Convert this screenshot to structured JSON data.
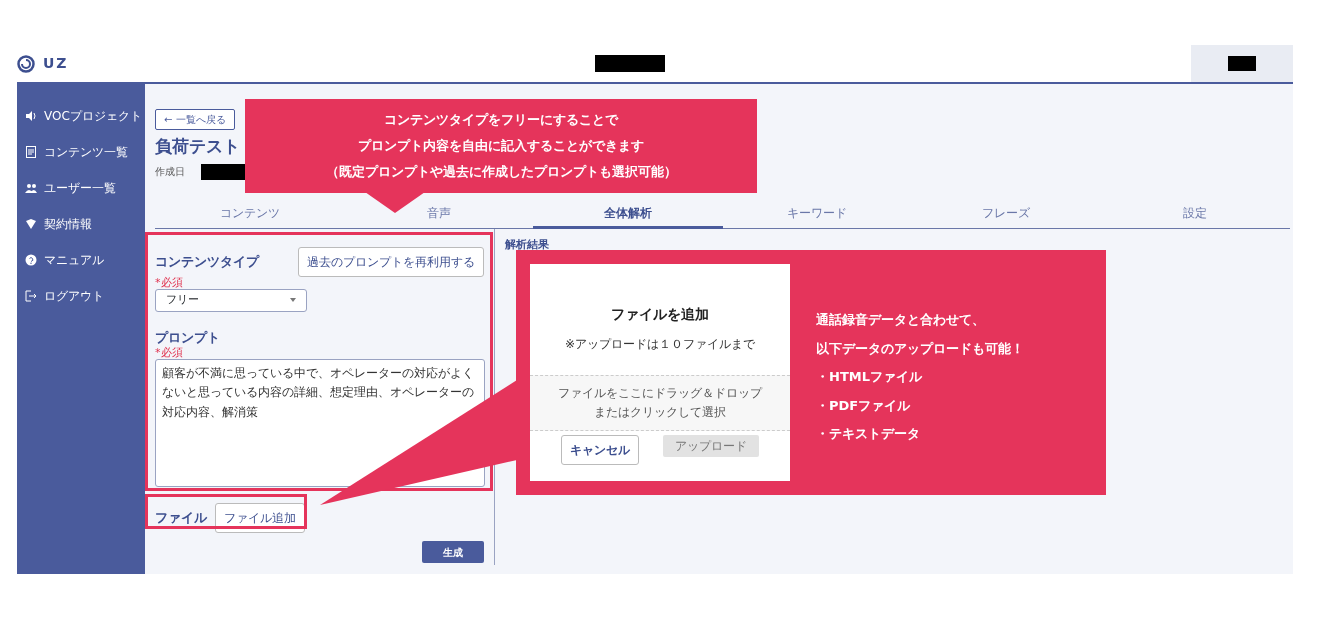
{
  "header": {
    "logo": "UZ"
  },
  "sidebar": {
    "items": [
      {
        "label": "VOCプロジェクト"
      },
      {
        "label": "コンテンツ一覧"
      },
      {
        "label": "ユーザー一覧"
      },
      {
        "label": "契約情報"
      },
      {
        "label": "マニュアル"
      },
      {
        "label": "ログアウト"
      }
    ]
  },
  "back_button": "← 一覧へ戻る",
  "title": "負荷テスト",
  "created_label": "作成日",
  "tabs": [
    {
      "label": "コンテンツ",
      "selected": false
    },
    {
      "label": "音声",
      "selected": false
    },
    {
      "label": "全体解析",
      "selected": true
    },
    {
      "label": "キーワード",
      "selected": false
    },
    {
      "label": "フレーズ",
      "selected": false
    },
    {
      "label": "設定",
      "selected": false
    }
  ],
  "content_type": {
    "heading": "コンテンツタイプ",
    "required": "*必須",
    "value": "フリー",
    "reuse_button": "過去のプロンプトを再利用する"
  },
  "prompt": {
    "heading": "プロンプト",
    "required": "*必須",
    "value": "顧客が不満に思っている中で、オペレーターの対応がよくないと思っている内容の詳細、想定理由、オペレーターの対応内容、解消策"
  },
  "file": {
    "heading": "ファイル",
    "button": "ファイル追加"
  },
  "generate_button": "生成",
  "result_heading": "解析結果",
  "callouts": [
    {
      "lines": [
        "コンテンツタイプをフリーにすることで",
        "プロンプト内容を自由に記入することができます",
        "（既定プロンプトや過去に作成したプロンプトも選択可能）"
      ]
    },
    {
      "lines": [
        "通話録音データと合わせて、",
        "以下データのアップロードも可能！",
        "・HTMLファイル",
        "・PDFファイル",
        "・テキストデータ"
      ]
    }
  ],
  "modal": {
    "title": "ファイルを追加",
    "note": "※アップロードは１０ファイルまで",
    "dropzone_lines": [
      "ファイルをここにドラッグ＆ドロップ",
      "またはクリックして選択"
    ],
    "cancel_button": "キャンセル",
    "upload_button": {
      "label": "アップロード",
      "disabled": true
    }
  }
}
